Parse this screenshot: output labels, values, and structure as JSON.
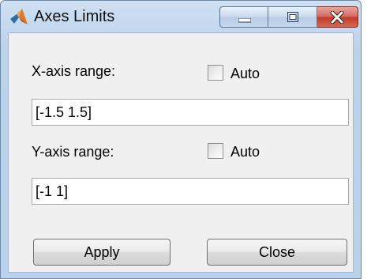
{
  "window": {
    "title": "Axes Limits",
    "app_icon": "matlab-membrane-icon",
    "controls": {
      "minimize": "minimize-icon",
      "maximize": "maximize-icon",
      "close": "close-icon"
    }
  },
  "xaxis": {
    "label": "X-axis range:",
    "auto_label": "Auto",
    "auto_checked": false,
    "value": "[-1.5 1.5]"
  },
  "yaxis": {
    "label": "Y-axis range:",
    "auto_label": "Auto",
    "auto_checked": false,
    "value": "[-1 1]"
  },
  "buttons": {
    "apply": "Apply",
    "close": "Close"
  },
  "colors": {
    "accent_close": "#c1392a",
    "frame": "#b9d1ea"
  }
}
